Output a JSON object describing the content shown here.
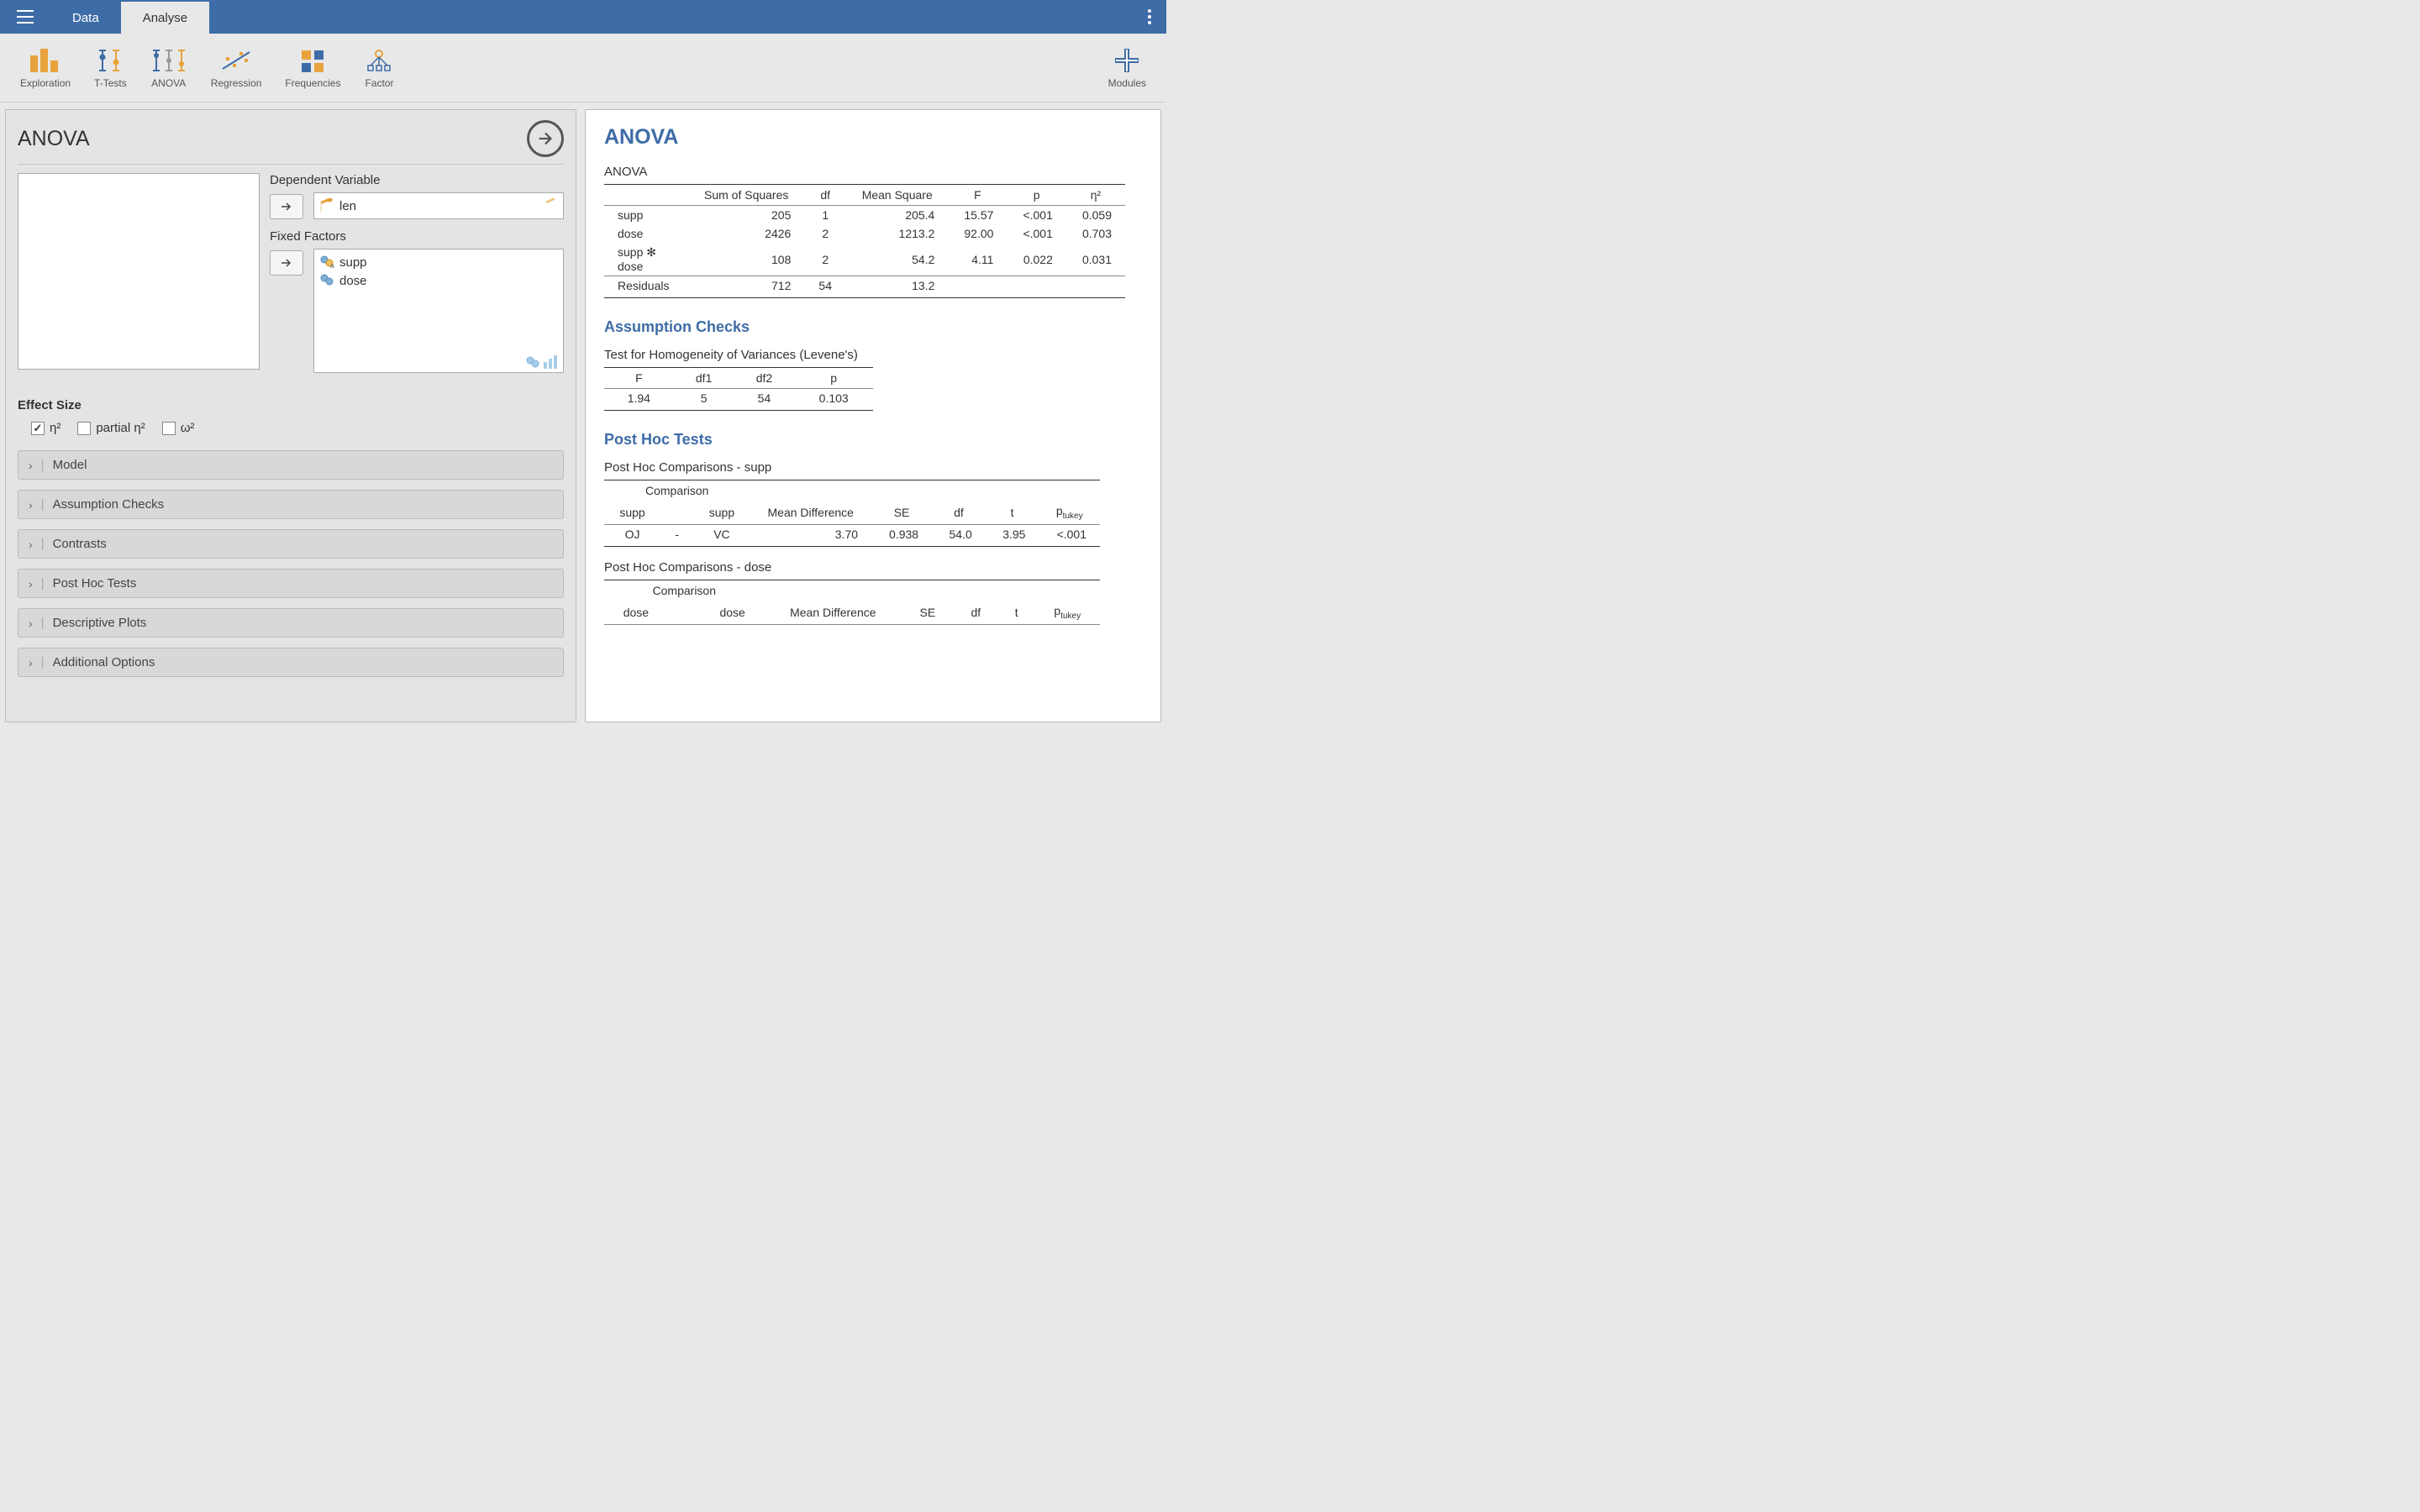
{
  "menubar": {
    "tabs": [
      "Data",
      "Analyse"
    ],
    "active_tab": 1
  },
  "ribbon": {
    "items": [
      "Exploration",
      "T-Tests",
      "ANOVA",
      "Regression",
      "Frequencies",
      "Factor"
    ],
    "modules": "Modules"
  },
  "left": {
    "title": "ANOVA",
    "dep_var_label": "Dependent Variable",
    "dep_var_value": "len",
    "fixed_factors_label": "Fixed Factors",
    "fixed_factors": [
      "supp",
      "dose"
    ],
    "effect_size_label": "Effect Size",
    "effect_size_options": [
      {
        "label": "η²",
        "checked": true
      },
      {
        "label": "partial η²",
        "checked": false
      },
      {
        "label": "ω²",
        "checked": false
      }
    ],
    "collapsibles": [
      "Model",
      "Assumption Checks",
      "Contrasts",
      "Post Hoc Tests",
      "Descriptive Plots",
      "Additional Options"
    ]
  },
  "output": {
    "title": "ANOVA",
    "anova_table": {
      "caption": "ANOVA",
      "headers": [
        "",
        "Sum of Squares",
        "df",
        "Mean Square",
        "F",
        "p",
        "η²"
      ],
      "rows": [
        [
          "supp",
          "205",
          "1",
          "205.4",
          "15.57",
          "<.001",
          "0.059"
        ],
        [
          "dose",
          "2426",
          "2",
          "1213.2",
          "92.00",
          "<.001",
          "0.703"
        ],
        [
          "supp ✻ dose",
          "108",
          "2",
          "54.2",
          "4.11",
          "0.022",
          "0.031"
        ]
      ],
      "footer": [
        "Residuals",
        "712",
        "54",
        "13.2",
        "",
        "",
        ""
      ]
    },
    "assumption_title": "Assumption Checks",
    "levene": {
      "caption": "Test for Homogeneity of Variances (Levene's)",
      "headers": [
        "F",
        "df1",
        "df2",
        "p"
      ],
      "row": [
        "1.94",
        "5",
        "54",
        "0.103"
      ]
    },
    "posthoc_title": "Post Hoc Tests",
    "posthoc_supp": {
      "caption": "Post Hoc Comparisons - supp",
      "comparison_label": "Comparison",
      "sub_headers": [
        "supp",
        "",
        "supp",
        "Mean Difference",
        "SE",
        "df",
        "t"
      ],
      "p_label": "p",
      "p_sub": "tukey",
      "rows": [
        [
          "OJ",
          "-",
          "VC",
          "3.70",
          "0.938",
          "54.0",
          "3.95",
          "<.001"
        ]
      ]
    },
    "posthoc_dose": {
      "caption": "Post Hoc Comparisons - dose",
      "comparison_label": "Comparison",
      "sub_headers": [
        "dose",
        "",
        "dose",
        "Mean Difference",
        "SE",
        "df",
        "t"
      ],
      "p_label": "p",
      "p_sub": "tukey"
    }
  }
}
